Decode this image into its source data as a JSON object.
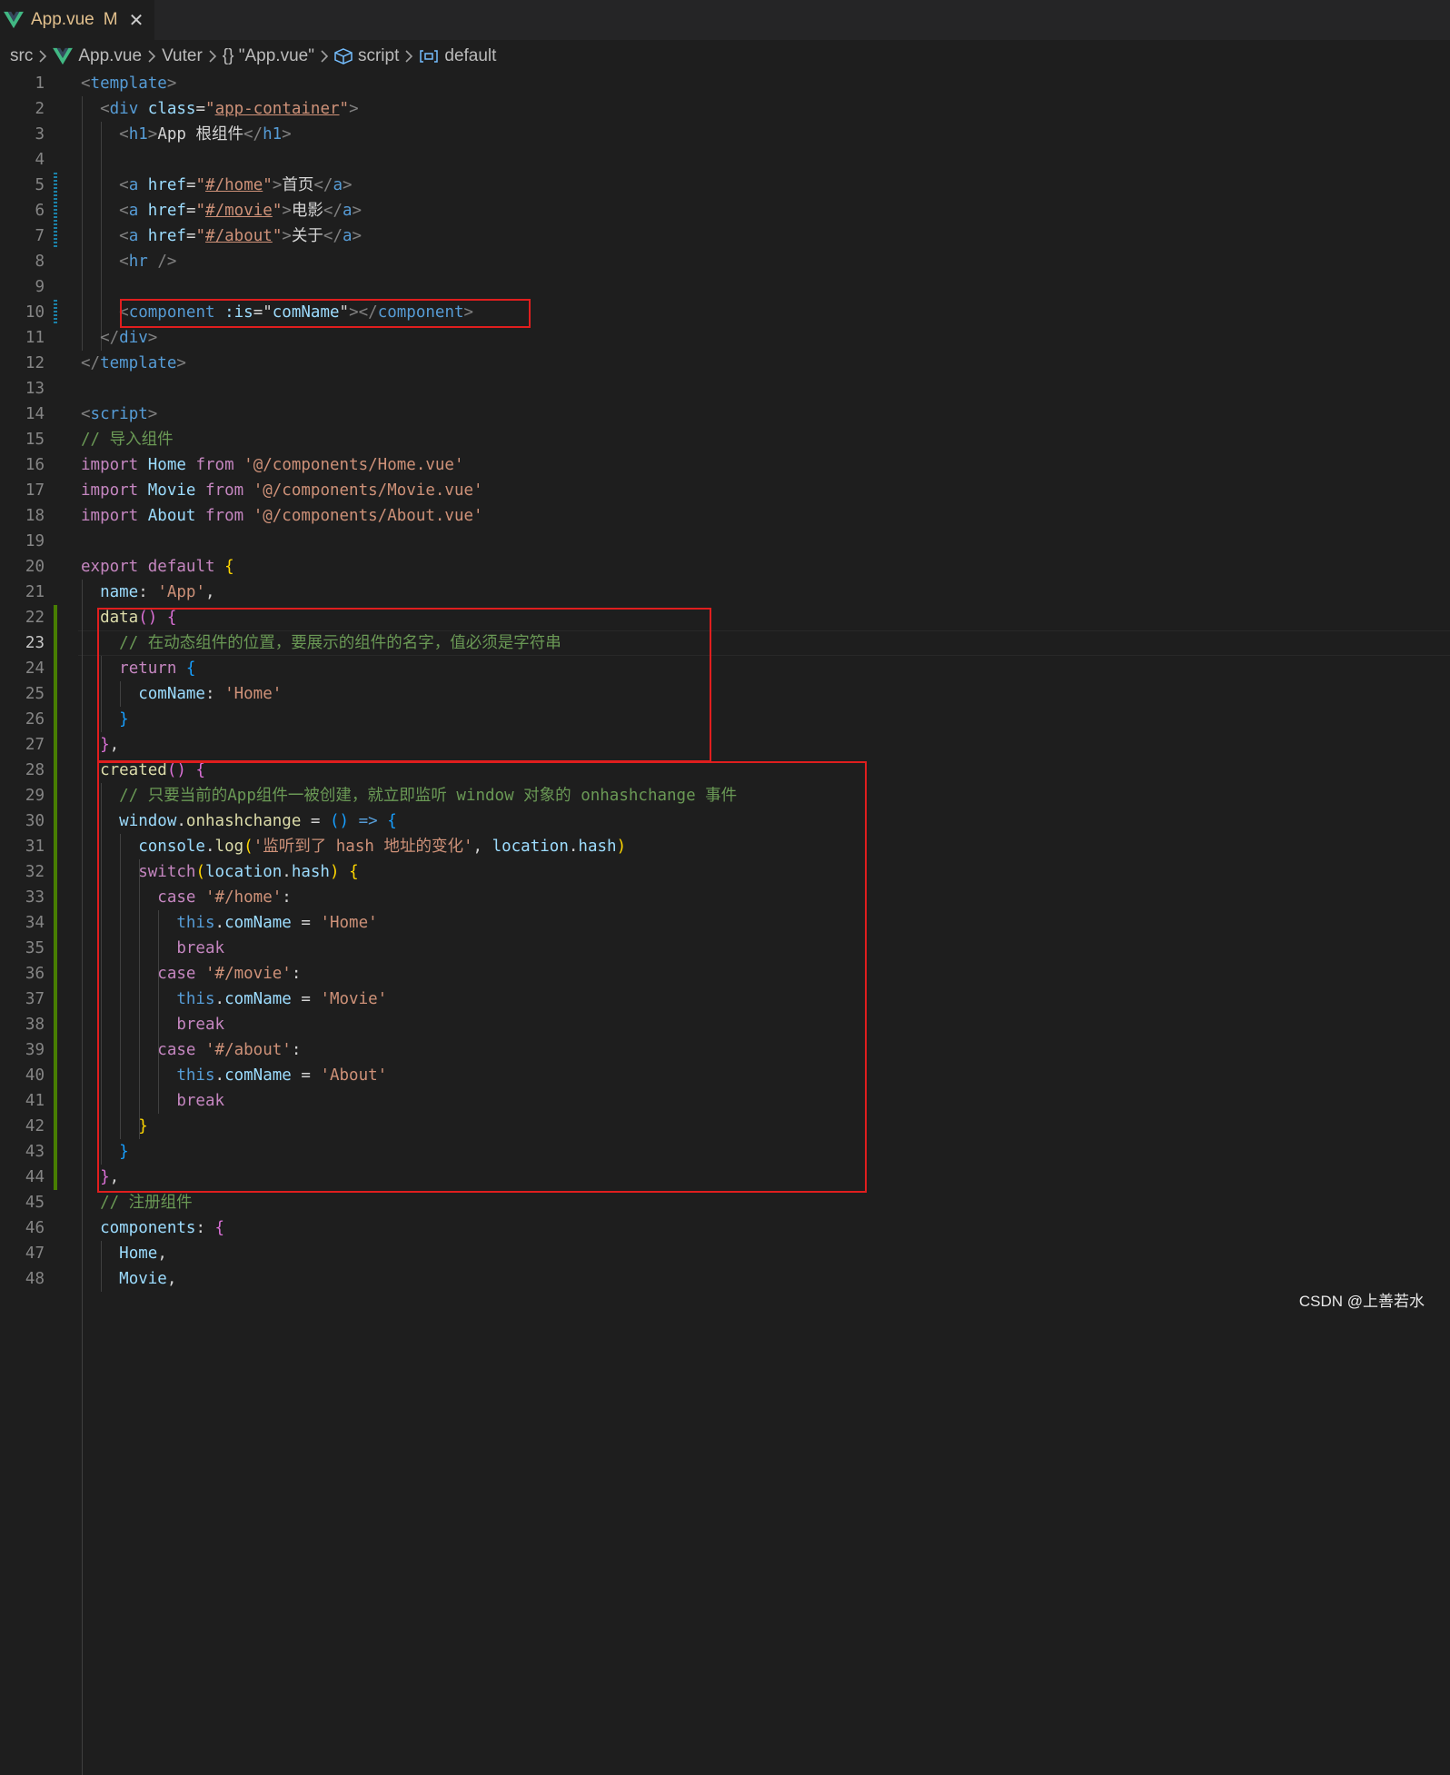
{
  "tab": {
    "icon": "vue-logo-icon",
    "filename": "App.vue",
    "status": "M",
    "close": "✕"
  },
  "breadcrumb": [
    "src",
    "App.vue",
    "Vuter",
    "{} \"App.vue\"",
    "script",
    "default"
  ],
  "colors": {
    "tag": "#569cd6",
    "punct": "#808080",
    "attr": "#9cdcfe",
    "string": "#ce9178",
    "comment": "#6a9955",
    "keyword": "#c586c0",
    "function": "#dcdcaa",
    "variable": "#9cdcfe",
    "text": "#d4d4d4",
    "keyword_blue": "#569cd6",
    "bracket1": "#ffd700",
    "bracket2": "#da70d6",
    "bracket3": "#179fff",
    "highlight_box": "#e01e1e",
    "modified_gutter": "#487e02"
  },
  "editor": {
    "active_line": 23,
    "lines": [
      {
        "n": "1",
        "t": [
          [
            "pun",
            "<"
          ],
          [
            "tag",
            "template"
          ],
          [
            "pun",
            ">"
          ]
        ]
      },
      {
        "n": "2",
        "t": [
          [
            "txt",
            "  "
          ],
          [
            "pun",
            "<"
          ],
          [
            "tag",
            "div"
          ],
          [
            "txt",
            " "
          ],
          [
            "attr",
            "class"
          ],
          [
            "txt",
            "="
          ],
          [
            "str",
            "\""
          ],
          [
            "str-u",
            "app-container"
          ],
          [
            "str",
            "\""
          ],
          [
            "pun",
            ">"
          ]
        ]
      },
      {
        "n": "3",
        "t": [
          [
            "txt",
            "    "
          ],
          [
            "pun",
            "<"
          ],
          [
            "tag",
            "h1"
          ],
          [
            "pun",
            ">"
          ],
          [
            "txt",
            "App 根组件"
          ],
          [
            "pun",
            "</"
          ],
          [
            "tag",
            "h1"
          ],
          [
            "pun",
            ">"
          ]
        ]
      },
      {
        "n": "4",
        "t": []
      },
      {
        "n": "5",
        "t": [
          [
            "txt",
            "    "
          ],
          [
            "pun",
            "<"
          ],
          [
            "tag",
            "a"
          ],
          [
            "txt",
            " "
          ],
          [
            "attr",
            "href"
          ],
          [
            "txt",
            "="
          ],
          [
            "str",
            "\""
          ],
          [
            "str-u",
            "#/home"
          ],
          [
            "str",
            "\""
          ],
          [
            "pun",
            ">"
          ],
          [
            "txt",
            "首页"
          ],
          [
            "pun",
            "</"
          ],
          [
            "tag",
            "a"
          ],
          [
            "pun",
            ">"
          ]
        ]
      },
      {
        "n": "6",
        "t": [
          [
            "txt",
            "    "
          ],
          [
            "pun",
            "<"
          ],
          [
            "tag",
            "a"
          ],
          [
            "txt",
            " "
          ],
          [
            "attr",
            "href"
          ],
          [
            "txt",
            "="
          ],
          [
            "str",
            "\""
          ],
          [
            "str-u",
            "#/movie"
          ],
          [
            "str",
            "\""
          ],
          [
            "pun",
            ">"
          ],
          [
            "txt",
            "电影"
          ],
          [
            "pun",
            "</"
          ],
          [
            "tag",
            "a"
          ],
          [
            "pun",
            ">"
          ]
        ]
      },
      {
        "n": "7",
        "t": [
          [
            "txt",
            "    "
          ],
          [
            "pun",
            "<"
          ],
          [
            "tag",
            "a"
          ],
          [
            "txt",
            " "
          ],
          [
            "attr",
            "href"
          ],
          [
            "txt",
            "="
          ],
          [
            "str",
            "\""
          ],
          [
            "str-u",
            "#/about"
          ],
          [
            "str",
            "\""
          ],
          [
            "pun",
            ">"
          ],
          [
            "txt",
            "关于"
          ],
          [
            "pun",
            "</"
          ],
          [
            "tag",
            "a"
          ],
          [
            "pun",
            ">"
          ]
        ]
      },
      {
        "n": "8",
        "t": [
          [
            "txt",
            "    "
          ],
          [
            "pun",
            "<"
          ],
          [
            "tag",
            "hr"
          ],
          [
            "txt",
            " "
          ],
          [
            "pun",
            "/>"
          ]
        ]
      },
      {
        "n": "9",
        "t": []
      },
      {
        "n": "10",
        "t": [
          [
            "txt",
            "    "
          ],
          [
            "pun",
            "<"
          ],
          [
            "tag",
            "component"
          ],
          [
            "txt",
            " "
          ],
          [
            "attr",
            ":is"
          ],
          [
            "txt",
            "=\""
          ],
          [
            "var",
            "comName"
          ],
          [
            "txt",
            "\""
          ],
          [
            "pun",
            "></"
          ],
          [
            "tag",
            "component"
          ],
          [
            "pun",
            ">"
          ]
        ]
      },
      {
        "n": "11",
        "t": [
          [
            "txt",
            "  "
          ],
          [
            "pun",
            "</"
          ],
          [
            "tag",
            "div"
          ],
          [
            "pun",
            ">"
          ]
        ]
      },
      {
        "n": "12",
        "t": [
          [
            "pun",
            "</"
          ],
          [
            "tag",
            "template"
          ],
          [
            "pun",
            ">"
          ]
        ]
      },
      {
        "n": "13",
        "t": []
      },
      {
        "n": "14",
        "t": [
          [
            "pun",
            "<"
          ],
          [
            "tag",
            "script"
          ],
          [
            "pun",
            ">"
          ]
        ]
      },
      {
        "n": "15",
        "t": [
          [
            "cmt",
            "// 导入组件"
          ]
        ]
      },
      {
        "n": "16",
        "t": [
          [
            "kw",
            "import"
          ],
          [
            "txt",
            " "
          ],
          [
            "var",
            "Home"
          ],
          [
            "txt",
            " "
          ],
          [
            "kw",
            "from"
          ],
          [
            "txt",
            " "
          ],
          [
            "str",
            "'@/components/Home.vue'"
          ]
        ]
      },
      {
        "n": "17",
        "t": [
          [
            "kw",
            "import"
          ],
          [
            "txt",
            " "
          ],
          [
            "var",
            "Movie"
          ],
          [
            "txt",
            " "
          ],
          [
            "kw",
            "from"
          ],
          [
            "txt",
            " "
          ],
          [
            "str",
            "'@/components/Movie.vue'"
          ]
        ]
      },
      {
        "n": "18",
        "t": [
          [
            "kw",
            "import"
          ],
          [
            "txt",
            " "
          ],
          [
            "var",
            "About"
          ],
          [
            "txt",
            " "
          ],
          [
            "kw",
            "from"
          ],
          [
            "txt",
            " "
          ],
          [
            "str",
            "'@/components/About.vue'"
          ]
        ]
      },
      {
        "n": "19",
        "t": []
      },
      {
        "n": "20",
        "t": [
          [
            "kw",
            "export"
          ],
          [
            "txt",
            " "
          ],
          [
            "kw",
            "default"
          ],
          [
            "txt",
            " "
          ],
          [
            "b1",
            "{"
          ]
        ]
      },
      {
        "n": "21",
        "t": [
          [
            "txt",
            "  "
          ],
          [
            "var",
            "name"
          ],
          [
            "txt",
            ": "
          ],
          [
            "str",
            "'App'"
          ],
          [
            "txt",
            ","
          ]
        ]
      },
      {
        "n": "22",
        "t": [
          [
            "txt",
            "  "
          ],
          [
            "fn",
            "data"
          ],
          [
            "b2",
            "()"
          ],
          [
            "txt",
            " "
          ],
          [
            "b2",
            "{"
          ]
        ]
      },
      {
        "n": "23",
        "t": [
          [
            "txt",
            "    "
          ],
          [
            "cmt",
            "// 在动态组件的位置，要展示的组件的名字，值必须是字符串"
          ]
        ]
      },
      {
        "n": "24",
        "t": [
          [
            "txt",
            "    "
          ],
          [
            "kw",
            "return"
          ],
          [
            "txt",
            " "
          ],
          [
            "b3",
            "{"
          ]
        ]
      },
      {
        "n": "25",
        "t": [
          [
            "txt",
            "      "
          ],
          [
            "var",
            "comName"
          ],
          [
            "txt",
            ": "
          ],
          [
            "str",
            "'Home'"
          ]
        ]
      },
      {
        "n": "26",
        "t": [
          [
            "txt",
            "    "
          ],
          [
            "b3",
            "}"
          ]
        ]
      },
      {
        "n": "27",
        "t": [
          [
            "txt",
            "  "
          ],
          [
            "b2",
            "}"
          ],
          [
            "txt",
            ","
          ]
        ]
      },
      {
        "n": "28",
        "t": [
          [
            "txt",
            "  "
          ],
          [
            "fn",
            "created"
          ],
          [
            "b2",
            "()"
          ],
          [
            "txt",
            " "
          ],
          [
            "b2",
            "{"
          ]
        ]
      },
      {
        "n": "29",
        "t": [
          [
            "txt",
            "    "
          ],
          [
            "cmt",
            "// 只要当前的App组件一被创建，就立即监听 window 对象的 onhashchange 事件"
          ]
        ]
      },
      {
        "n": "30",
        "t": [
          [
            "txt",
            "    "
          ],
          [
            "var",
            "window"
          ],
          [
            "txt",
            "."
          ],
          [
            "fn",
            "onhashchange"
          ],
          [
            "txt",
            " = "
          ],
          [
            "b3",
            "()"
          ],
          [
            "txt",
            " "
          ],
          [
            "kw2",
            "=>"
          ],
          [
            "txt",
            " "
          ],
          [
            "b3",
            "{"
          ]
        ]
      },
      {
        "n": "31",
        "t": [
          [
            "txt",
            "      "
          ],
          [
            "var",
            "console"
          ],
          [
            "txt",
            "."
          ],
          [
            "fn",
            "log"
          ],
          [
            "b1",
            "("
          ],
          [
            "str",
            "'监听到了 hash 地址的变化'"
          ],
          [
            "txt",
            ", "
          ],
          [
            "var",
            "location"
          ],
          [
            "txt",
            "."
          ],
          [
            "var",
            "hash"
          ],
          [
            "b1",
            ")"
          ]
        ]
      },
      {
        "n": "32",
        "t": [
          [
            "txt",
            "      "
          ],
          [
            "kw",
            "switch"
          ],
          [
            "b1",
            "("
          ],
          [
            "var",
            "location"
          ],
          [
            "txt",
            "."
          ],
          [
            "var",
            "hash"
          ],
          [
            "b1",
            ")"
          ],
          [
            "txt",
            " "
          ],
          [
            "b1",
            "{"
          ]
        ]
      },
      {
        "n": "33",
        "t": [
          [
            "txt",
            "        "
          ],
          [
            "kw",
            "case"
          ],
          [
            "txt",
            " "
          ],
          [
            "str",
            "'#/home'"
          ],
          [
            "txt",
            ":"
          ]
        ]
      },
      {
        "n": "34",
        "t": [
          [
            "txt",
            "          "
          ],
          [
            "kw2",
            "this"
          ],
          [
            "txt",
            "."
          ],
          [
            "var",
            "comName"
          ],
          [
            "txt",
            " = "
          ],
          [
            "str",
            "'Home'"
          ]
        ]
      },
      {
        "n": "35",
        "t": [
          [
            "txt",
            "          "
          ],
          [
            "kw",
            "break"
          ]
        ]
      },
      {
        "n": "36",
        "t": [
          [
            "txt",
            "        "
          ],
          [
            "kw",
            "case"
          ],
          [
            "txt",
            " "
          ],
          [
            "str",
            "'#/movie'"
          ],
          [
            "txt",
            ":"
          ]
        ]
      },
      {
        "n": "37",
        "t": [
          [
            "txt",
            "          "
          ],
          [
            "kw2",
            "this"
          ],
          [
            "txt",
            "."
          ],
          [
            "var",
            "comName"
          ],
          [
            "txt",
            " = "
          ],
          [
            "str",
            "'Movie'"
          ]
        ]
      },
      {
        "n": "38",
        "t": [
          [
            "txt",
            "          "
          ],
          [
            "kw",
            "break"
          ]
        ]
      },
      {
        "n": "39",
        "t": [
          [
            "txt",
            "        "
          ],
          [
            "kw",
            "case"
          ],
          [
            "txt",
            " "
          ],
          [
            "str",
            "'#/about'"
          ],
          [
            "txt",
            ":"
          ]
        ]
      },
      {
        "n": "40",
        "t": [
          [
            "txt",
            "          "
          ],
          [
            "kw2",
            "this"
          ],
          [
            "txt",
            "."
          ],
          [
            "var",
            "comName"
          ],
          [
            "txt",
            " = "
          ],
          [
            "str",
            "'About'"
          ]
        ]
      },
      {
        "n": "41",
        "t": [
          [
            "txt",
            "          "
          ],
          [
            "kw",
            "break"
          ]
        ]
      },
      {
        "n": "42",
        "t": [
          [
            "txt",
            "      "
          ],
          [
            "b1",
            "}"
          ]
        ]
      },
      {
        "n": "43",
        "t": [
          [
            "txt",
            "    "
          ],
          [
            "b3",
            "}"
          ]
        ]
      },
      {
        "n": "44",
        "t": [
          [
            "txt",
            "  "
          ],
          [
            "b2",
            "}"
          ],
          [
            "txt",
            ","
          ]
        ]
      },
      {
        "n": "45",
        "t": [
          [
            "txt",
            "  "
          ],
          [
            "cmt",
            "// 注册组件"
          ]
        ]
      },
      {
        "n": "46",
        "t": [
          [
            "txt",
            "  "
          ],
          [
            "var",
            "components"
          ],
          [
            "txt",
            ": "
          ],
          [
            "b2",
            "{"
          ]
        ]
      },
      {
        "n": "47",
        "t": [
          [
            "txt",
            "    "
          ],
          [
            "var",
            "Home"
          ],
          [
            "txt",
            ","
          ]
        ]
      },
      {
        "n": "48",
        "t": [
          [
            "txt",
            "    "
          ],
          [
            "var",
            "Movie"
          ],
          [
            "txt",
            ","
          ]
        ]
      }
    ]
  },
  "watermark": "CSDN @上善若水"
}
